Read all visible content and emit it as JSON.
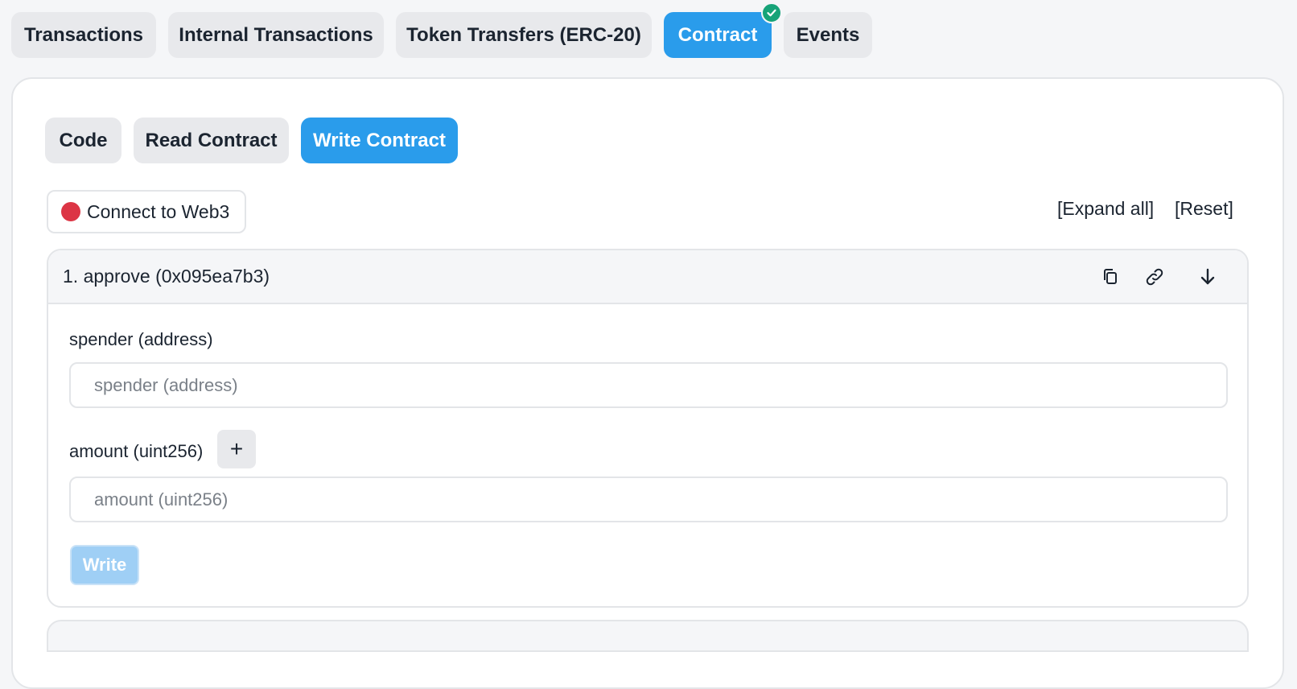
{
  "top_tabs": [
    {
      "label": "Transactions",
      "active": false
    },
    {
      "label": "Internal Transactions",
      "active": false
    },
    {
      "label": "Token Transfers (ERC-20)",
      "active": false
    },
    {
      "label": "Contract",
      "active": true,
      "verified": true
    },
    {
      "label": "Events",
      "active": false
    }
  ],
  "contract_tabs": [
    {
      "label": "Code",
      "active": false
    },
    {
      "label": "Read Contract",
      "active": false
    },
    {
      "label": "Write Contract",
      "active": true
    }
  ],
  "connect": {
    "label": "Connect to Web3",
    "status_color": "#dc3545"
  },
  "actions": {
    "expand_all": "[Expand all]",
    "reset": "[Reset]"
  },
  "function": {
    "title": "1. approve (0x095ea7b3)",
    "icons": [
      "copy-icon",
      "link-icon",
      "arrow-down-icon"
    ],
    "params": [
      {
        "label": "spender (address)",
        "placeholder": "spender (address)",
        "value": ""
      },
      {
        "label": "amount (uint256)",
        "placeholder": "amount (uint256)",
        "value": "",
        "has_plus": true
      }
    ],
    "plus_label": "+",
    "write_label": "Write"
  },
  "colors": {
    "accent": "#2a9ceb",
    "verified": "#16a378",
    "disconnected": "#dc3545",
    "write_disabled": "#9fcff5"
  }
}
